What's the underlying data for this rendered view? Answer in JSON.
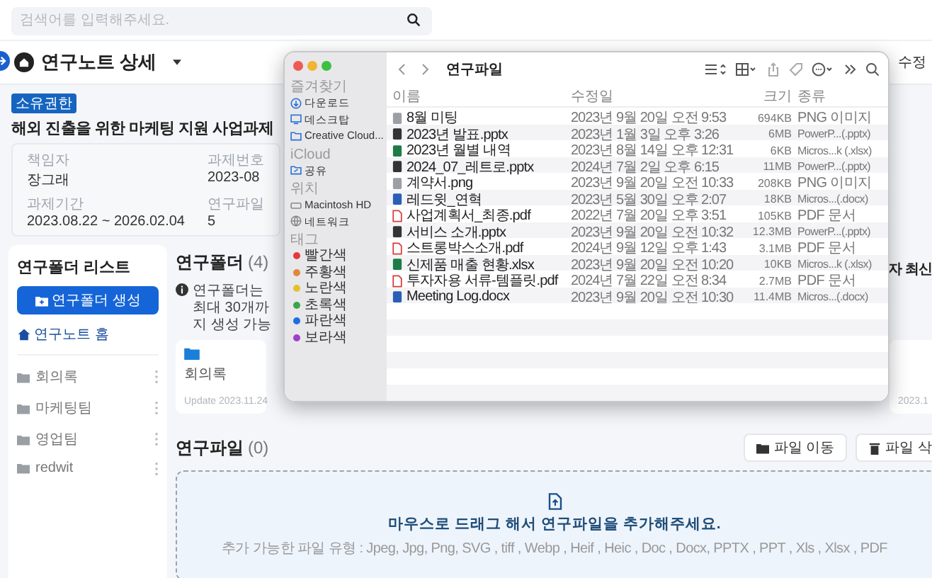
{
  "search": {
    "placeholder": "검색어를 입력해주세요."
  },
  "header": {
    "title": "연구노트 상세",
    "edit_button": "수정"
  },
  "project": {
    "badge": "소유권한",
    "title": "해외 진출을 위한 마케팅 지원 사업과제",
    "info": [
      {
        "label": "책임자",
        "value": "장그래"
      },
      {
        "label": "과제번호",
        "value": "2023-08"
      },
      {
        "label": "과제기간",
        "value": "2023.08.22 ~ 2026.02.04"
      },
      {
        "label": "연구파일",
        "value": "5"
      }
    ]
  },
  "folder_panel": {
    "title": "연구폴더 리스트",
    "create_button": "연구폴더 생성",
    "home_link": "연구노트 홈",
    "folders": [
      "회의록",
      "마케팅팀",
      "영업팀",
      "redwit"
    ]
  },
  "folders_section": {
    "title": "연구폴더",
    "count": "(4)",
    "notice": "연구폴더는 최대 30개까지 생성 가능",
    "sort": "자 최신",
    "cards": [
      {
        "name": "회의록",
        "updated": "Update 2023.11.24"
      },
      {
        "updated": "2023.1"
      }
    ]
  },
  "files_section": {
    "title": "연구파일",
    "count": "(0)",
    "buttons": [
      {
        "kind": "move",
        "label": "파일 이동"
      },
      {
        "kind": "delete",
        "label": "파일 삭"
      }
    ],
    "dropzone": {
      "message": "마우스로 드래그 해서 연구파일을 추가해주세요.",
      "hint": "추가 가능한 파일 유형 : Jpeg, Jpg, Png, SVG , tiff , Webp , Heif , Heic , Doc , Docx, PPTX , PPT , Xls , Xlsx , PDF"
    }
  },
  "finder": {
    "title": "연구파일",
    "sidebar": [
      {
        "heading": "즐겨찾기",
        "items": [
          {
            "kind": "download",
            "label": "다운로드"
          },
          {
            "kind": "desktop",
            "label": "데스크탑"
          },
          {
            "kind": "folder",
            "label": "Creative Cloud..."
          }
        ]
      },
      {
        "heading": "iCloud",
        "items": [
          {
            "kind": "shared",
            "label": "공유"
          }
        ]
      },
      {
        "heading": "위치",
        "items": [
          {
            "kind": "disk",
            "label": "Macintosh HD"
          },
          {
            "kind": "network",
            "label": "네트워크"
          }
        ]
      },
      {
        "heading": "태그",
        "items": [
          {
            "kind": "tag",
            "label": "빨간색",
            "color": "#e5383b"
          },
          {
            "kind": "tag",
            "label": "주황색",
            "color": "#e0883a"
          },
          {
            "kind": "tag",
            "label": "노란색",
            "color": "#e2c229"
          },
          {
            "kind": "tag",
            "label": "초록색",
            "color": "#3aa64a"
          },
          {
            "kind": "tag",
            "label": "파란색",
            "color": "#1f6fe0"
          },
          {
            "kind": "tag",
            "label": "보라색",
            "color": "#a040c8"
          }
        ]
      }
    ],
    "columns": [
      "이름",
      "수정일",
      "크기",
      "종류"
    ],
    "files": [
      {
        "kind": "image",
        "name": "8월 미팅",
        "modified": "2023년 9월 20일 오전 9:53",
        "size": "694KB",
        "type": "PNG 이미지"
      },
      {
        "kind": "pptx",
        "name": "2023년 발표.pptx",
        "modified": "2023년 1월 3일 오후 3:26",
        "size": "6MB",
        "type": "PowerP...(.pptx)"
      },
      {
        "kind": "xlsx",
        "name": "2023년 월별 내역",
        "modified": "2023년 8월 14일 오후 12:31",
        "size": "6KB",
        "type": "Micros...k (.xlsx)"
      },
      {
        "kind": "pptx",
        "name": "2024_07_레트로.pptx",
        "modified": "2024년 7월 2일 오후 6:15",
        "size": "11MB",
        "type": "PowerP...(.pptx)"
      },
      {
        "kind": "image",
        "name": "계약서.png",
        "modified": "2023년 9월 20일 오전 10:33",
        "size": "208KB",
        "type": "PNG 이미지"
      },
      {
        "kind": "docx",
        "name": "레드윗_연혁",
        "modified": "2023년 5월 30일 오후 2:07",
        "size": "18KB",
        "type": "Micros...(.docx)"
      },
      {
        "kind": "pdf",
        "name": "사업계획서_최종.pdf",
        "modified": "2022년 7월 20일 오후 3:51",
        "size": "105KB",
        "type": "PDF 문서"
      },
      {
        "kind": "pptx",
        "name": "서비스 소개.pptx",
        "modified": "2023년 9월 20일 오전 10:32",
        "size": "12.3MB",
        "type": "PowerP...(.pptx)"
      },
      {
        "kind": "pdf",
        "name": "스트롱박스소개.pdf",
        "modified": "2024년 9월 12일 오후 1:43",
        "size": "3.1MB",
        "type": "PDF 문서"
      },
      {
        "kind": "xlsx",
        "name": "신제품 매출 현황.xlsx",
        "modified": "2023년 9월 20일 오전 10:20",
        "size": "10KB",
        "type": "Micros...k (.xlsx)"
      },
      {
        "kind": "pdf",
        "name": "투자자용 서류-템플릿.pdf",
        "modified": "2024년 7월 22일 오전 8:34",
        "size": "2.7MB",
        "type": "PDF 문서"
      },
      {
        "kind": "docx",
        "name": "Meeting Log.docx",
        "modified": "2023년 9월 20일 오전 10:30",
        "size": "11.4MB",
        "type": "Micros...(.docx)"
      }
    ]
  }
}
